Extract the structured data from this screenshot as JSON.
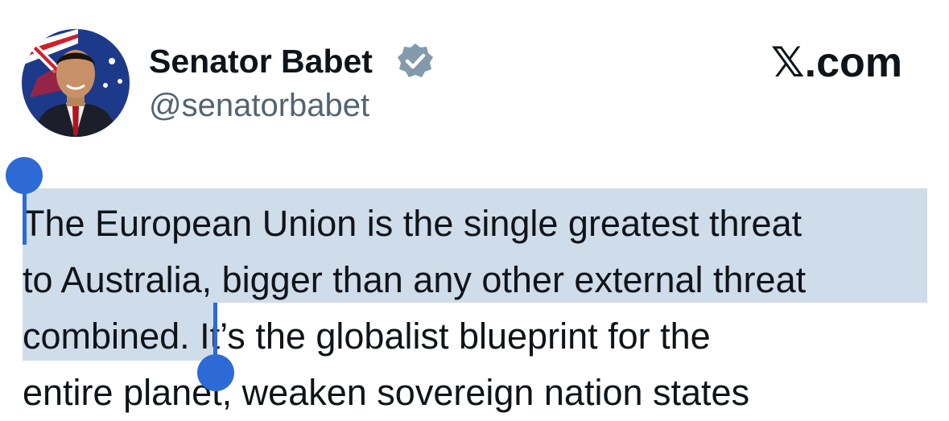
{
  "author": {
    "display_name": "Senator Babet",
    "handle": "@senatorbabet",
    "verified": true,
    "avatar_icon": "profile-photo-avatar"
  },
  "brand": {
    "text": ".com",
    "logo_icon": "x-logo-icon"
  },
  "tweet": {
    "lines": [
      "The European Union is the single greatest threat",
      "to Australia, bigger than any other external threat",
      "combined. It’s the globalist blueprint for the",
      "entire planet, weaken sovereign nation states"
    ]
  },
  "selection": {
    "color": "#cfdcea",
    "handle_color": "#2e6ad6"
  }
}
